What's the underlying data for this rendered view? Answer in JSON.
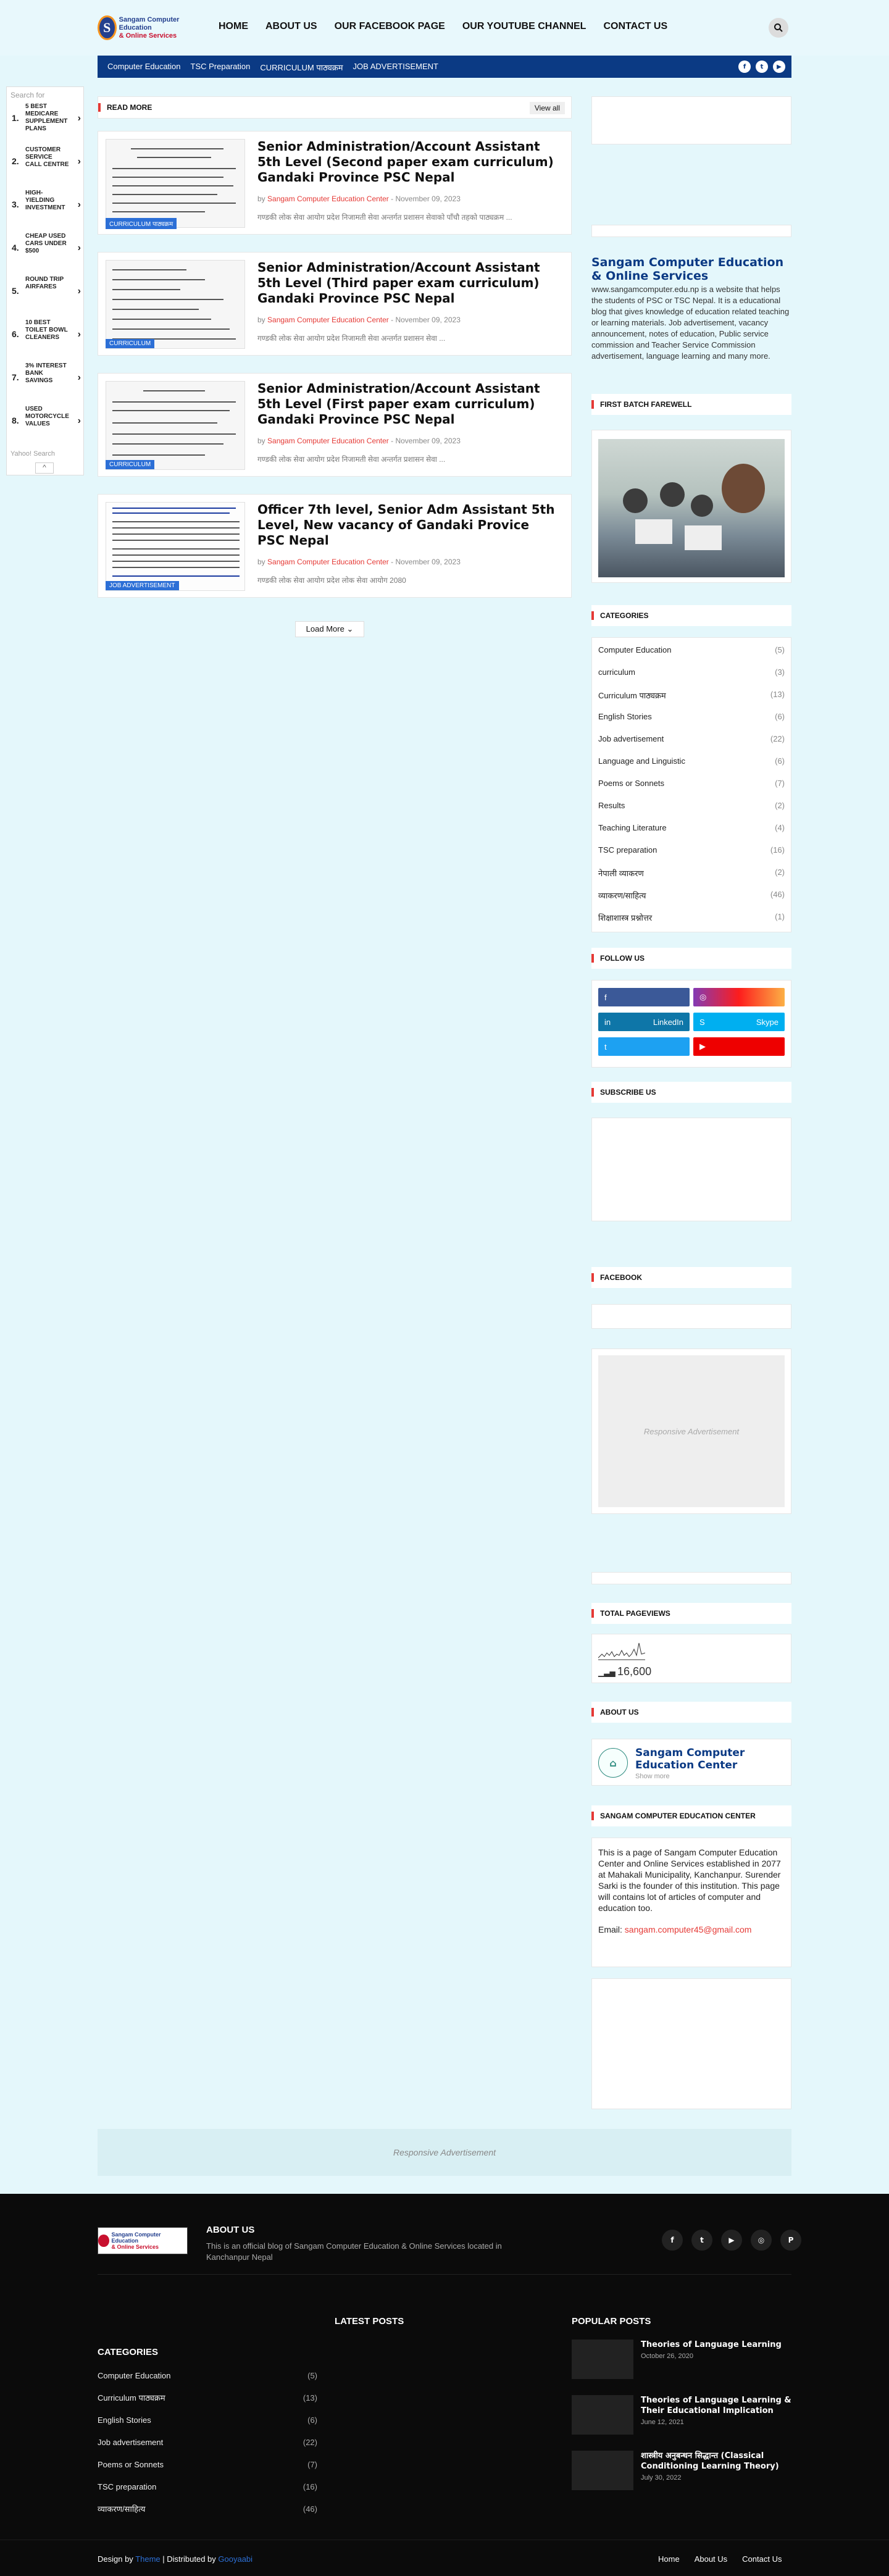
{
  "header": {
    "logo_line1": "Sangam Computer Education",
    "logo_line2": "& Online Services",
    "nav": [
      "HOME",
      "ABOUT US",
      "OUR FACEBOOK PAGE",
      "OUR YOUTUBE CHANNEL",
      "CONTACT US"
    ]
  },
  "subnav": {
    "links": [
      "Computer Education",
      "TSC Preparation",
      "CURRICULUM पाठ्यक्रम",
      "JOB ADVERTISEMENT"
    ],
    "social": [
      "f",
      "t",
      "▶"
    ]
  },
  "left_ads": {
    "search_label": "Search for",
    "items": [
      {
        "n": "1.",
        "t": "5 BEST MEDICARE SUPPLEMENT PLANS"
      },
      {
        "n": "2.",
        "t": "CUSTOMER SERVICE CALL CENTRE"
      },
      {
        "n": "3.",
        "t": "HIGH-YIELDING INVESTMENT"
      },
      {
        "n": "4.",
        "t": "CHEAP USED CARS UNDER $500"
      },
      {
        "n": "5.",
        "t": "ROUND TRIP AIRFARES"
      },
      {
        "n": "6.",
        "t": "10 BEST TOILET BOWL CLEANERS"
      },
      {
        "n": "7.",
        "t": "3% INTEREST BANK SAVINGS"
      },
      {
        "n": "8.",
        "t": "USED MOTORCYCLE VALUES"
      }
    ],
    "footer_label": "Yahoo! Search"
  },
  "main": {
    "read_more": "READ MORE",
    "view_all": "View all",
    "load_more": "Load More",
    "posts": [
      {
        "title": "Senior Administration/Account Assistant 5th Level (Second paper exam curriculum) Gandaki Province PSC Nepal",
        "category": "CURRICULUM पाठ्यक्रम",
        "author": "Sangam Computer Education Center",
        "date": "November 09, 2023",
        "excerpt": "गण्डकी लोक सेवा आयोग प्रदेश निजामती सेवा अन्तर्गत प्रशासन सेवाको पाँचौ तहको पाठ्यक्रम ..."
      },
      {
        "title": "Senior Administration/Account Assistant 5th Level (Third paper exam curriculum) Gandaki Province PSC Nepal",
        "category": "CURRICULUM",
        "author": "Sangam Computer Education Center",
        "date": "November 09, 2023",
        "excerpt": "गण्डकी लोक सेवा आयोग प्रदेश निजामती सेवा अन्तर्गत प्रशासन सेवा ..."
      },
      {
        "title": "Senior Administration/Account Assistant 5th Level (First paper exam curriculum) Gandaki Province PSC Nepal",
        "category": "CURRICULUM",
        "author": "Sangam Computer Education Center",
        "date": "November 09, 2023",
        "excerpt": "गण्डकी लोक सेवा आयोग प्रदेश निजामती सेवा अन्तर्गत प्रशासन सेवा ..."
      },
      {
        "title": "Officer 7th level, Senior Adm Assistant 5th Level, New vacancy of Gandaki Provice PSC Nepal",
        "category": "JOB ADVERTISEMENT",
        "author": "Sangam Computer Education Center",
        "date": "November 09, 2023",
        "excerpt": "गण्डकी लोक सेवा आयोग प्रदेश लोक सेवा आयोग  2080"
      }
    ]
  },
  "sidebar": {
    "about_title": "Sangam Computer Education & Online Services",
    "about_text": "www.sangamcomputer.edu.np is a website that helps the students of PSC or TSC Nepal. It is a educational blog that gives knowledge of education related teaching or learning materials. Job advertisement, vacancy announcement, notes of education, Public service commission and Teacher Service Commission advertisement, language learning and many more.",
    "farewell_title": "FIRST BATCH FAREWELL",
    "categories_title": "CATEGORIES",
    "categories": [
      {
        "name": "Computer Education",
        "count": "(5)"
      },
      {
        "name": "curriculum",
        "count": "(3)"
      },
      {
        "name": "Curriculum पाठ्यक्रम",
        "count": "(13)"
      },
      {
        "name": "English Stories",
        "count": "(6)"
      },
      {
        "name": "Job advertisement",
        "count": "(22)"
      },
      {
        "name": "Language and Linguistic",
        "count": "(6)"
      },
      {
        "name": "Poems or Sonnets",
        "count": "(7)"
      },
      {
        "name": "Results",
        "count": "(2)"
      },
      {
        "name": "Teaching Literature",
        "count": "(4)"
      },
      {
        "name": "TSC preparation",
        "count": "(16)"
      },
      {
        "name": "नेपाली व्याकरण",
        "count": "(2)"
      },
      {
        "name": "व्याकरण/साहित्य",
        "count": "(46)"
      },
      {
        "name": "शिक्षाशास्त्र प्रश्नोत्तर",
        "count": "(1)"
      }
    ],
    "follow_title": "FOLLOW US",
    "follow": [
      {
        "icon": "f",
        "label": "",
        "color": "#3b5998"
      },
      {
        "icon": "◎",
        "label": "",
        "color": "#d6249f"
      },
      {
        "icon": "in",
        "label": "LinkedIn",
        "color": "#0e76a8"
      },
      {
        "icon": "S",
        "label": "Skype",
        "color": "#00aff0"
      },
      {
        "icon": "t",
        "label": "",
        "color": "#1da1f2"
      },
      {
        "icon": "▶",
        "label": "",
        "color": "#e00"
      }
    ],
    "subscribe_title": "SUBSCRIBE US",
    "facebook_title": "FACEBOOK",
    "ad_text": "Responsive Advertisement",
    "pageviews_title": "TOTAL PAGEVIEWS",
    "pageviews": "16,600",
    "aboutus_title": "ABOUT US",
    "profile_name": "Sangam Computer Education Center",
    "profile_more": "Show more",
    "center_title": "SANGAM COMPUTER EDUCATION CENTER",
    "center_text": "This is a page of Sangam Computer Education Center and Online Services established in 2077 at Mahakali Municipality, Kanchanpur. Surender Sarki is the founder of this institution. This page will contains lot of articles of computer and education too.",
    "center_email_label": "Email:",
    "center_email": "sangam.computer45@gmail.com"
  },
  "bottom_ad": "Responsive Advertisement",
  "footer": {
    "about_title": "ABOUT US",
    "about_text": "This is an official blog of Sangam Computer Education & Online Services located in Kanchanpur Nepal",
    "latest_title": "LATEST POSTS",
    "popular_title": "POPULAR POSTS",
    "categories_title": "CATEGORIES",
    "categories": [
      {
        "name": "Computer Education",
        "count": "(5)"
      },
      {
        "name": "Curriculum पाठ्यक्रम",
        "count": "(13)"
      },
      {
        "name": "English Stories",
        "count": "(6)"
      },
      {
        "name": "Job advertisement",
        "count": "(22)"
      },
      {
        "name": "Poems or Sonnets",
        "count": "(7)"
      },
      {
        "name": "TSC preparation",
        "count": "(16)"
      },
      {
        "name": "व्याकरण/साहित्य",
        "count": "(46)"
      }
    ],
    "popular": [
      {
        "title": "Theories of Language Learning",
        "date": "October 26, 2020"
      },
      {
        "title": "Theories of Language Learning & Their Educational Implication",
        "date": "June 12, 2021"
      },
      {
        "title": "शास्त्रीय अनुबन्धन सिद्धान्त (Classical Conditioning Learning Theory)",
        "date": "July 30, 2022"
      }
    ],
    "social": [
      "f",
      "t",
      "▶",
      "◎",
      "P"
    ],
    "design_by": "Design by",
    "theme": "Theme",
    "distributed_by": "| Distributed by",
    "gooyaabi": "Gooyaabi",
    "links": [
      "Home",
      "About Us",
      "Contact Us"
    ]
  }
}
